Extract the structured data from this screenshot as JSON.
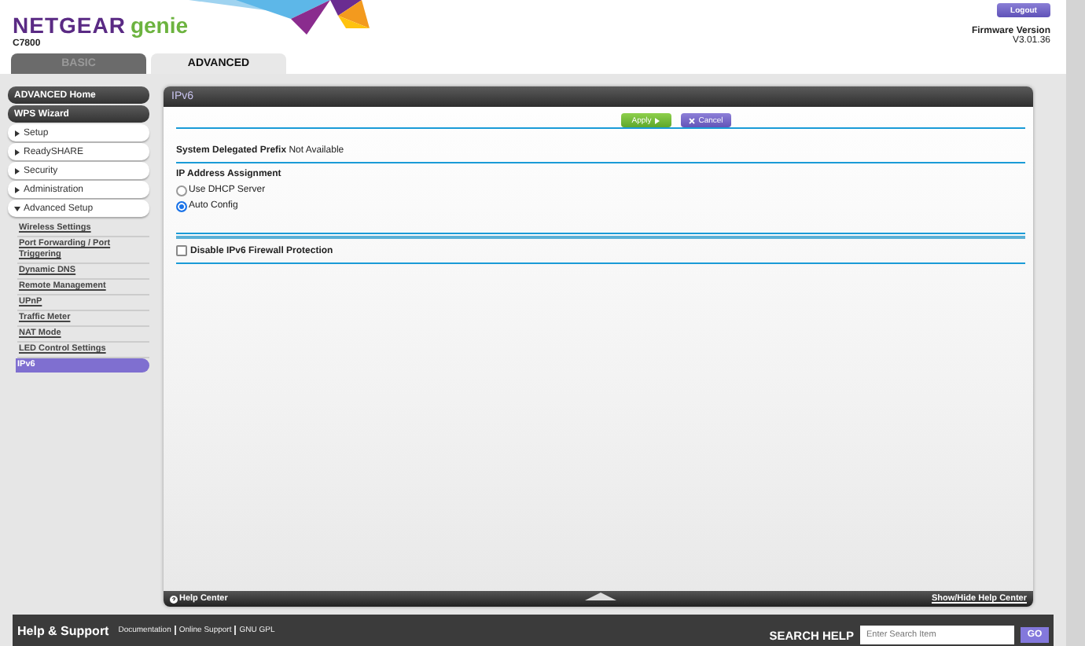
{
  "header": {
    "brand": "NETGEAR",
    "product": "genie",
    "model": "C7800",
    "logout": "Logout",
    "firmware_label": "Firmware Version",
    "firmware_version": "V3.01.36"
  },
  "tabs": [
    {
      "label": "BASIC",
      "selected": false
    },
    {
      "label": "ADVANCED",
      "selected": true
    }
  ],
  "sidebar": {
    "items": [
      {
        "kind": "link",
        "label": "ADVANCED Home"
      },
      {
        "kind": "link",
        "label": "WPS Wizard"
      },
      {
        "kind": "section",
        "label": "Setup",
        "expanded": false
      },
      {
        "kind": "section",
        "label": "ReadySHARE",
        "expanded": false
      },
      {
        "kind": "section",
        "label": "Security",
        "expanded": false
      },
      {
        "kind": "section",
        "label": "Administration",
        "expanded": false
      },
      {
        "kind": "section",
        "label": "Advanced Setup",
        "expanded": true,
        "children": [
          {
            "label": "Wireless Settings",
            "selected": false
          },
          {
            "label": "Port Forwarding / Port Triggering",
            "selected": false
          },
          {
            "label": "Dynamic DNS",
            "selected": false
          },
          {
            "label": "Remote Management",
            "selected": false
          },
          {
            "label": "UPnP",
            "selected": false
          },
          {
            "label": "Traffic Meter",
            "selected": false
          },
          {
            "label": "NAT Mode",
            "selected": false
          },
          {
            "label": "LED Control Settings",
            "selected": false
          },
          {
            "label": "IPv6",
            "selected": true
          }
        ]
      }
    ]
  },
  "panel": {
    "title": "IPv6",
    "buttons": [
      {
        "kind": "apply",
        "label": "Apply"
      },
      {
        "kind": "cancel",
        "label": "Cancel"
      }
    ],
    "prefix": {
      "label": "System Delegated Prefix",
      "value": "Not Available"
    },
    "assignment": {
      "label": "IP Address Assignment",
      "options": [
        {
          "label": "Use DHCP Server",
          "selected": false
        },
        {
          "label": "Auto Config",
          "selected": true
        }
      ]
    },
    "firewall": {
      "label": "Disable IPv6 Firewall Protection",
      "checked": false
    },
    "help_bar": {
      "label": "Help Center",
      "toggle": "Show/Hide Help Center"
    }
  },
  "footer": {
    "title": "Help & Support",
    "links": [
      "Documentation",
      "Online Support",
      "GNU GPL"
    ],
    "search_label": "SEARCH HELP",
    "search_placeholder": "Enter Search Item",
    "go": "GO"
  }
}
